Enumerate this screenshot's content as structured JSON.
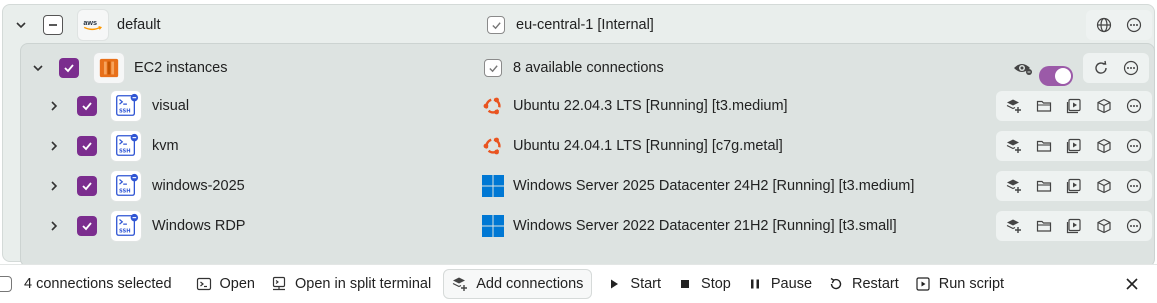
{
  "root": {
    "name": "default",
    "provider_icon": "aws-logo-icon",
    "region": "eu-central-1 [Internal]",
    "actions": [
      "globe-icon",
      "more-icon"
    ]
  },
  "group": {
    "name": "EC2 instances",
    "status": "8 available connections",
    "toggle_on": true,
    "actions": [
      "refresh-icon",
      "more-icon"
    ]
  },
  "connections": [
    {
      "name": "visual",
      "os": "ubuntu",
      "description": "Ubuntu 22.04.3 LTS [Running] [t3.medium]"
    },
    {
      "name": "kvm",
      "os": "ubuntu",
      "description": "Ubuntu 24.04.1 LTS [Running] [c7g.metal]"
    },
    {
      "name": "windows-2025",
      "os": "windows",
      "description": "Windows Server 2025 Datacenter 24H2 [Running] [t3.medium]"
    },
    {
      "name": "Windows RDP",
      "os": "windows",
      "description": "Windows Server 2022 Datacenter 21H2 [Running] [t3.small]"
    }
  ],
  "ssh_label": "SSH",
  "bottombar": {
    "selected": "4 connections selected",
    "open": "Open",
    "open_split": "Open in split terminal",
    "add": "Add connections",
    "start": "Start",
    "stop": "Stop",
    "pause": "Pause",
    "restart": "Restart",
    "run_script": "Run script"
  },
  "colors": {
    "accent": "#7b2d8e",
    "ubuntu": "#e95420",
    "windows": "#0078d4",
    "aws_orange": "#ff9900",
    "ec2_orange": "#e8701a",
    "ssh_blue": "#2f55d4"
  }
}
